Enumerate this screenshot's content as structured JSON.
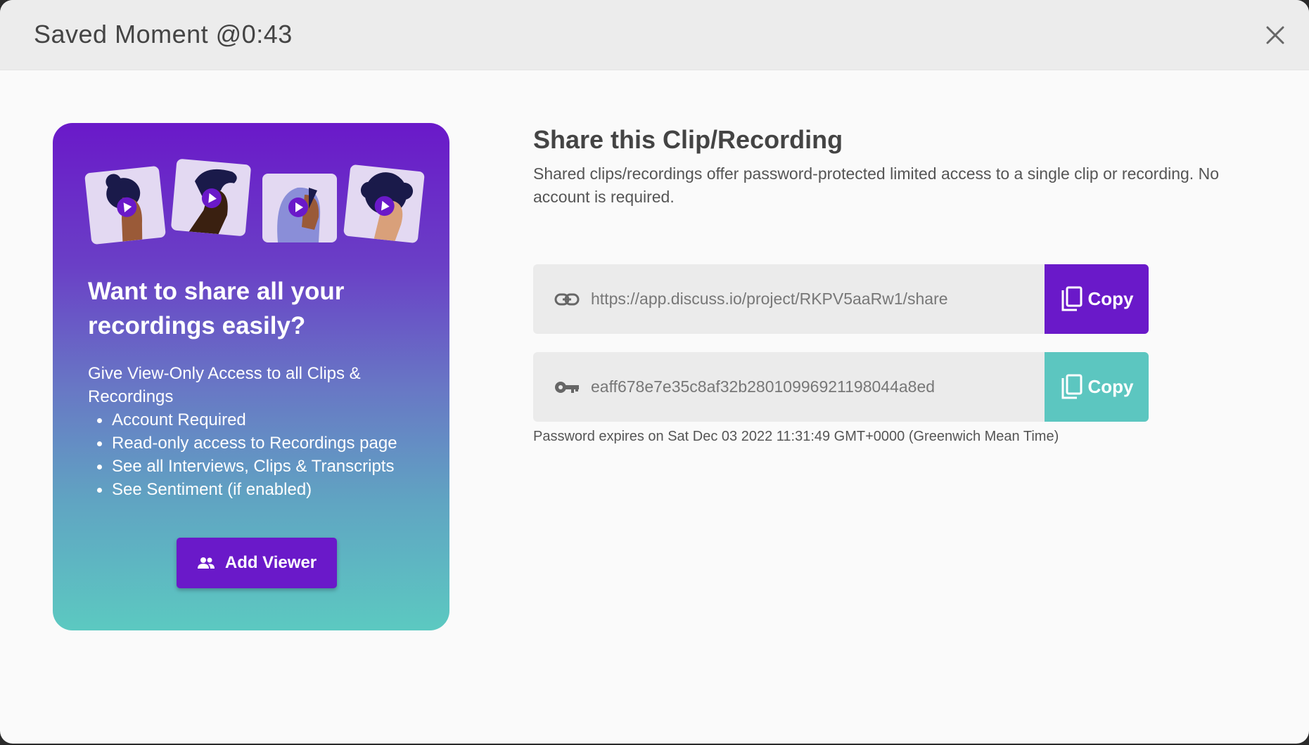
{
  "modal": {
    "title": "Saved Moment @0:43"
  },
  "promo": {
    "heading": "Want to share all your recordings easily?",
    "intro": "Give View-Only Access to all Clips & Recordings",
    "bullets": [
      "Account Required",
      "Read-only access to Recordings page",
      "See all Interviews, Clips & Transcripts",
      "See Sentiment (if enabled)"
    ],
    "add_viewer_label": "Add Viewer"
  },
  "share": {
    "title": "Share this Clip/Recording",
    "description": "Shared clips/recordings offer password-protected limited access to a single clip or recording. No account is required.",
    "link": "https://app.discuss.io/project/RKPV5aaRw1/share",
    "password": "eaff678e7e35c8af32b2801099692119804 4a8ed",
    "copy_label": "Copy",
    "expiry": "Password expires on Sat Dec 03 2022 11:31:49 GMT+0000 (Greenwich Mean Time)"
  },
  "colors": {
    "primary_purple": "#6a19c9",
    "teal": "#5cc6c0"
  },
  "icons": {
    "close": "close-icon",
    "link": "link-icon",
    "key": "key-icon",
    "copy": "copy-icon",
    "people": "people-icon",
    "play": "play-icon"
  }
}
